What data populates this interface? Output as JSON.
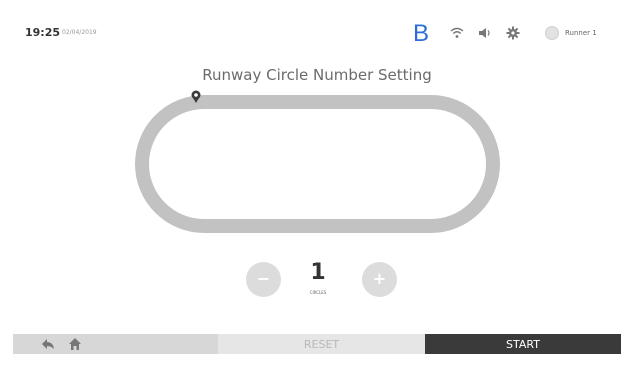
{
  "status_bar": {
    "time": "19:25",
    "date": "02/04/2019",
    "bluetooth_letter": "B",
    "icons": [
      "wifi-icon",
      "volume-icon",
      "gear-icon",
      "user-avatar-icon"
    ],
    "user_name": "Runner 1"
  },
  "main": {
    "title": "Runway Circle Number Setting",
    "counter": {
      "value": "1",
      "unit": "CIRCLES",
      "decrement_label": "−",
      "increment_label": "+"
    }
  },
  "bottom_bar": {
    "back_icon": "back-arrow-icon",
    "home_icon": "home-icon",
    "reset_label": "RESET",
    "start_label": "START"
  },
  "colors": {
    "track": "#c2c2c2",
    "start_button": "#3a3a3a",
    "reset_button": "#e6e6e6",
    "nav_section": "#d7d7d7",
    "bluetooth_accent": "#2b6fd6"
  }
}
